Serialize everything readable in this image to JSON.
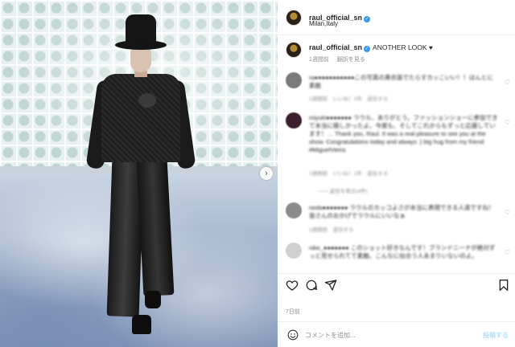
{
  "post": {
    "username": "raul_official_sn",
    "location": "Milan,Italy",
    "caption": "ANOTHER LOOK",
    "caption_time": "1週間前",
    "translate_label": "翻訳を見る"
  },
  "comments": [
    {
      "text": "ra●●●●●●●●●●●この写真の黒衣装でたらすカッこいい！！ほんとに素敵",
      "meta": "1週間前　いいね！1件　返信する",
      "avatar_color": "#7a7a7a"
    },
    {
      "text": "miyuki●●●●●●● ラウル、ありがとう。ファッションショーに参加できて本当に嬉しかったよ。今度も、そしてこれからもずっと応援しています！… Thank you, Raul. It was a real pleasure to see you at the show. Congratulations today and always :) big hug from my friend #MiguelVieira",
      "meta": "1週間前　いいね！1件　返信する",
      "avatar_color": "#3a1f2e"
    },
    {
      "text": "noda●●●●●●● ラウルのカッコよさが本当に表現できる人達ですね！皆さんのおかげでラウルにいいなぁ",
      "meta": "1週間前　返信する",
      "avatar_color": "#8b8b8b"
    },
    {
      "text": "nike_●●●●●●● このショット好きなんです！ブランドニーナが絶対ずっと見せられてて素敵。こんなに似合う人あまりいないのよ。",
      "meta": "",
      "avatar_color": "#d0d0d0"
    }
  ],
  "replies_label": "—— 返信を表示(4件)",
  "date_label": "7日前",
  "comment_placeholder": "コメントを追加...",
  "post_label": "投稿する"
}
